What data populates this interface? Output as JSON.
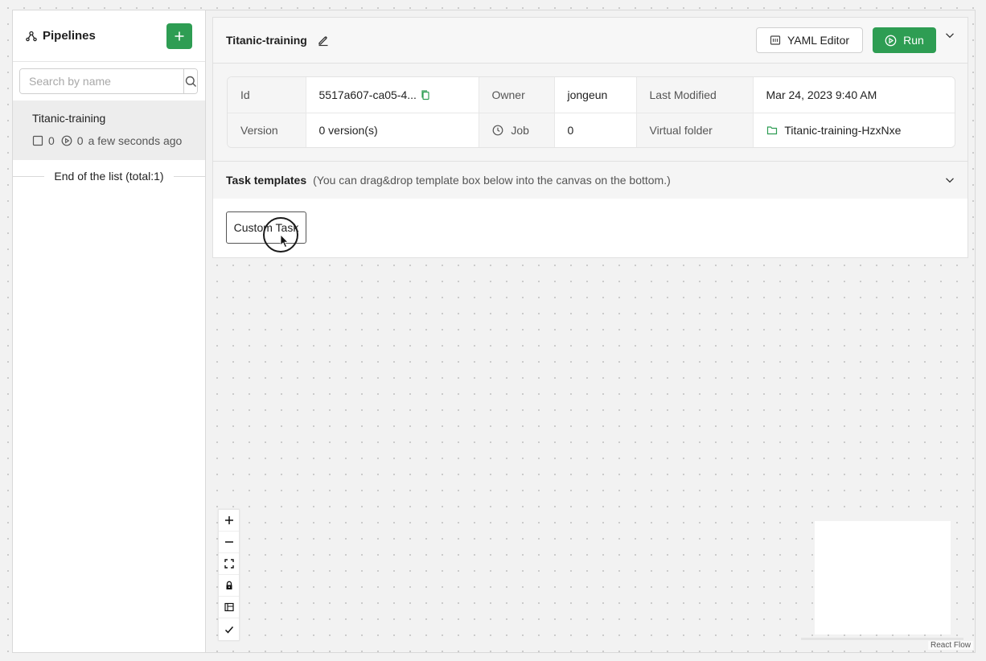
{
  "sidebar": {
    "title": "Pipelines",
    "search_placeholder": "Search by name",
    "items": [
      {
        "name": "Titanic-training",
        "count_a": "0",
        "count_b": "0",
        "time": "a few seconds ago"
      }
    ],
    "end_text": "End of the list (total:1)"
  },
  "header": {
    "title": "Titanic-training",
    "yaml_label": "YAML Editor",
    "run_label": "Run"
  },
  "info": {
    "id_label": "Id",
    "id_value": "5517a607-ca05-4...",
    "owner_label": "Owner",
    "owner_value": "jongeun",
    "modified_label": "Last Modified",
    "modified_value": "Mar 24, 2023 9:40 AM",
    "version_label": "Version",
    "version_value": "0 version(s)",
    "job_label": "Job",
    "job_value": "0",
    "folder_label": "Virtual folder",
    "folder_value": "Titanic-training-HzxNxe"
  },
  "templates": {
    "title": "Task templates",
    "hint": "(You can drag&drop template box below into the canvas on the bottom.)",
    "items": [
      "Custom Task"
    ]
  },
  "canvas": {
    "attribution": "React Flow"
  },
  "colors": {
    "accent": "#2e9d53"
  }
}
